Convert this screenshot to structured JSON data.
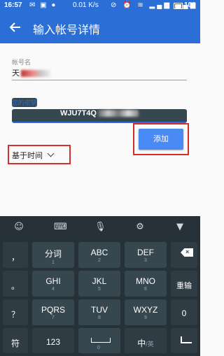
{
  "status_bar": {
    "time": "16:57",
    "speed": "0.01",
    "speed_unit": "K/s",
    "battery": "100"
  },
  "app_bar": {
    "title": "输入帐号详情"
  },
  "form": {
    "account_label": "帐号名",
    "account_value_visible": "天",
    "key_label": "您的密钥",
    "key_value_visible": "WJU7T4Q",
    "type_selected": "基于时间",
    "add_button": "添加"
  },
  "keyboard": {
    "rows": [
      {
        "side": "，",
        "keys": [
          {
            "main": "分词",
            "sub": "1"
          },
          {
            "main": "ABC",
            "sub": "2"
          },
          {
            "main": "DEF",
            "sub": "3"
          }
        ]
      },
      {
        "side": "。",
        "keys": [
          {
            "main": "GHI",
            "sub": "4"
          },
          {
            "main": "JKL",
            "sub": "5"
          },
          {
            "main": "MNO",
            "sub": "6"
          }
        ],
        "action": "重输"
      },
      {
        "side": "？",
        "keys": [
          {
            "main": "PQRS",
            "sub": "7"
          },
          {
            "main": "TUV",
            "sub": "8"
          },
          {
            "main": "WXYZ",
            "sub": "9"
          }
        ],
        "action": "0"
      },
      {
        "side": "符",
        "keys": [
          {
            "main": "123",
            "sub": ""
          },
          {
            "main": "",
            "sub": ""
          },
          {
            "main": "中",
            "sub": ""
          }
        ]
      }
    ],
    "exclaim": "！",
    "mid_space": "0",
    "lang_suffix": "/英"
  }
}
